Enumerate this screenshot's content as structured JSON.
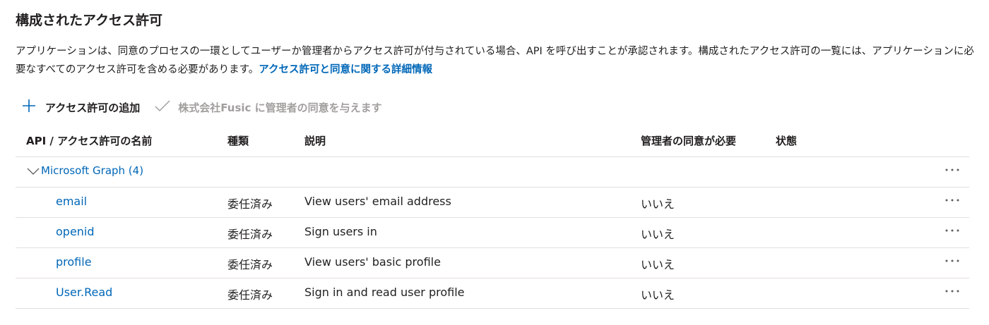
{
  "header": {
    "title": "構成されたアクセス許可"
  },
  "description": {
    "text": "アプリケーションは、同意のプロセスの一環としてユーザーか管理者からアクセス許可が付与されている場合、API を呼び出すことが承認されます。構成されたアクセス許可の一覧には、アプリケーションに必要なすべてのアクセス許可を含める必要があります。",
    "link_label": "アクセス許可と同意に関する詳細情報"
  },
  "toolbar": {
    "add_label": "アクセス許可の追加",
    "add_icon": "plus-icon",
    "consent_label": "株式会社Fusic に管理者の同意を与えます",
    "consent_icon": "checkmark-icon"
  },
  "table": {
    "columns": {
      "api": "API / アクセス許可の名前",
      "type": "種類",
      "description": "説明",
      "admin_consent": "管理者の同意が必要",
      "status": "状態"
    },
    "group": {
      "label": "Microsoft Graph (4)",
      "icon": "chevron-down-icon"
    },
    "rows": [
      {
        "name": "email",
        "type": "委任済み",
        "description": "View users' email address",
        "admin_consent": "いいえ"
      },
      {
        "name": "openid",
        "type": "委任済み",
        "description": "Sign users in",
        "admin_consent": "いいえ"
      },
      {
        "name": "profile",
        "type": "委任済み",
        "description": "View users' basic profile",
        "admin_consent": "いいえ"
      },
      {
        "name": "User.Read",
        "type": "委任済み",
        "description": "Sign in and read user profile",
        "admin_consent": "いいえ"
      }
    ]
  },
  "colors": {
    "link": "#0067b8",
    "text": "#201f1e",
    "disabled": "#a19f9d",
    "divider": "#e1dfdd"
  }
}
